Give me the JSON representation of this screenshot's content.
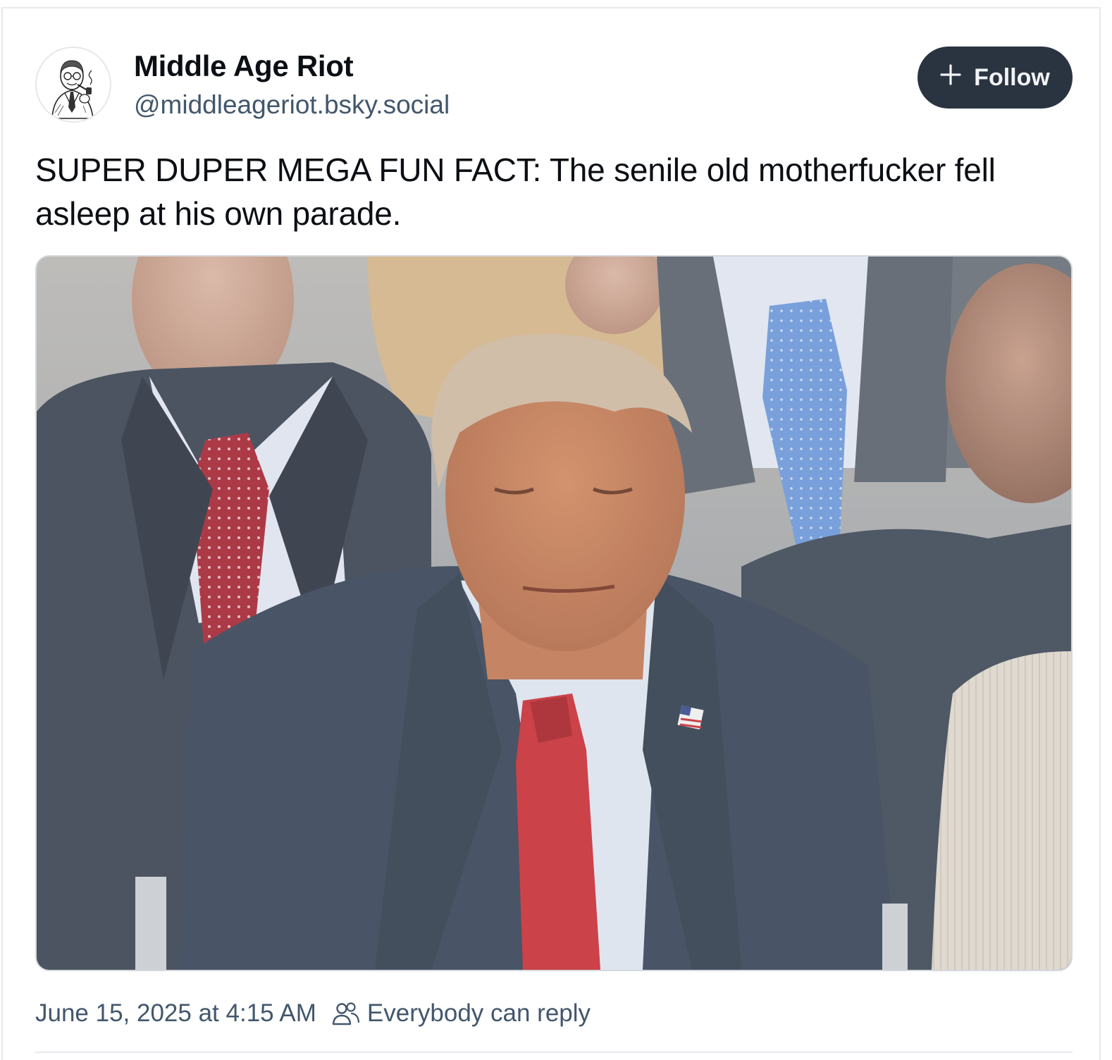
{
  "author": {
    "display_name": "Middle Age Riot",
    "handle": "@middleageriot.bsky.social",
    "avatar_icon": "vintage-man-with-pipe-avatar"
  },
  "follow_button": {
    "icon": "plus-icon",
    "label": "Follow"
  },
  "post": {
    "text": "SUPER DUPER MEGA FUN FACT: The senile old motherfucker fell asleep at his own parade.",
    "image": {
      "icon": "photo-of-seated-men-in-suits"
    }
  },
  "footer": {
    "timestamp": "June 15, 2025 at 4:15 AM",
    "reply_icon": "people-icon",
    "reply_setting": "Everybody can reply"
  },
  "colors": {
    "text_primary": "#0b0f14",
    "text_secondary": "#42576c",
    "follow_bg": "#2a3441",
    "border": "#e6e9ed"
  }
}
